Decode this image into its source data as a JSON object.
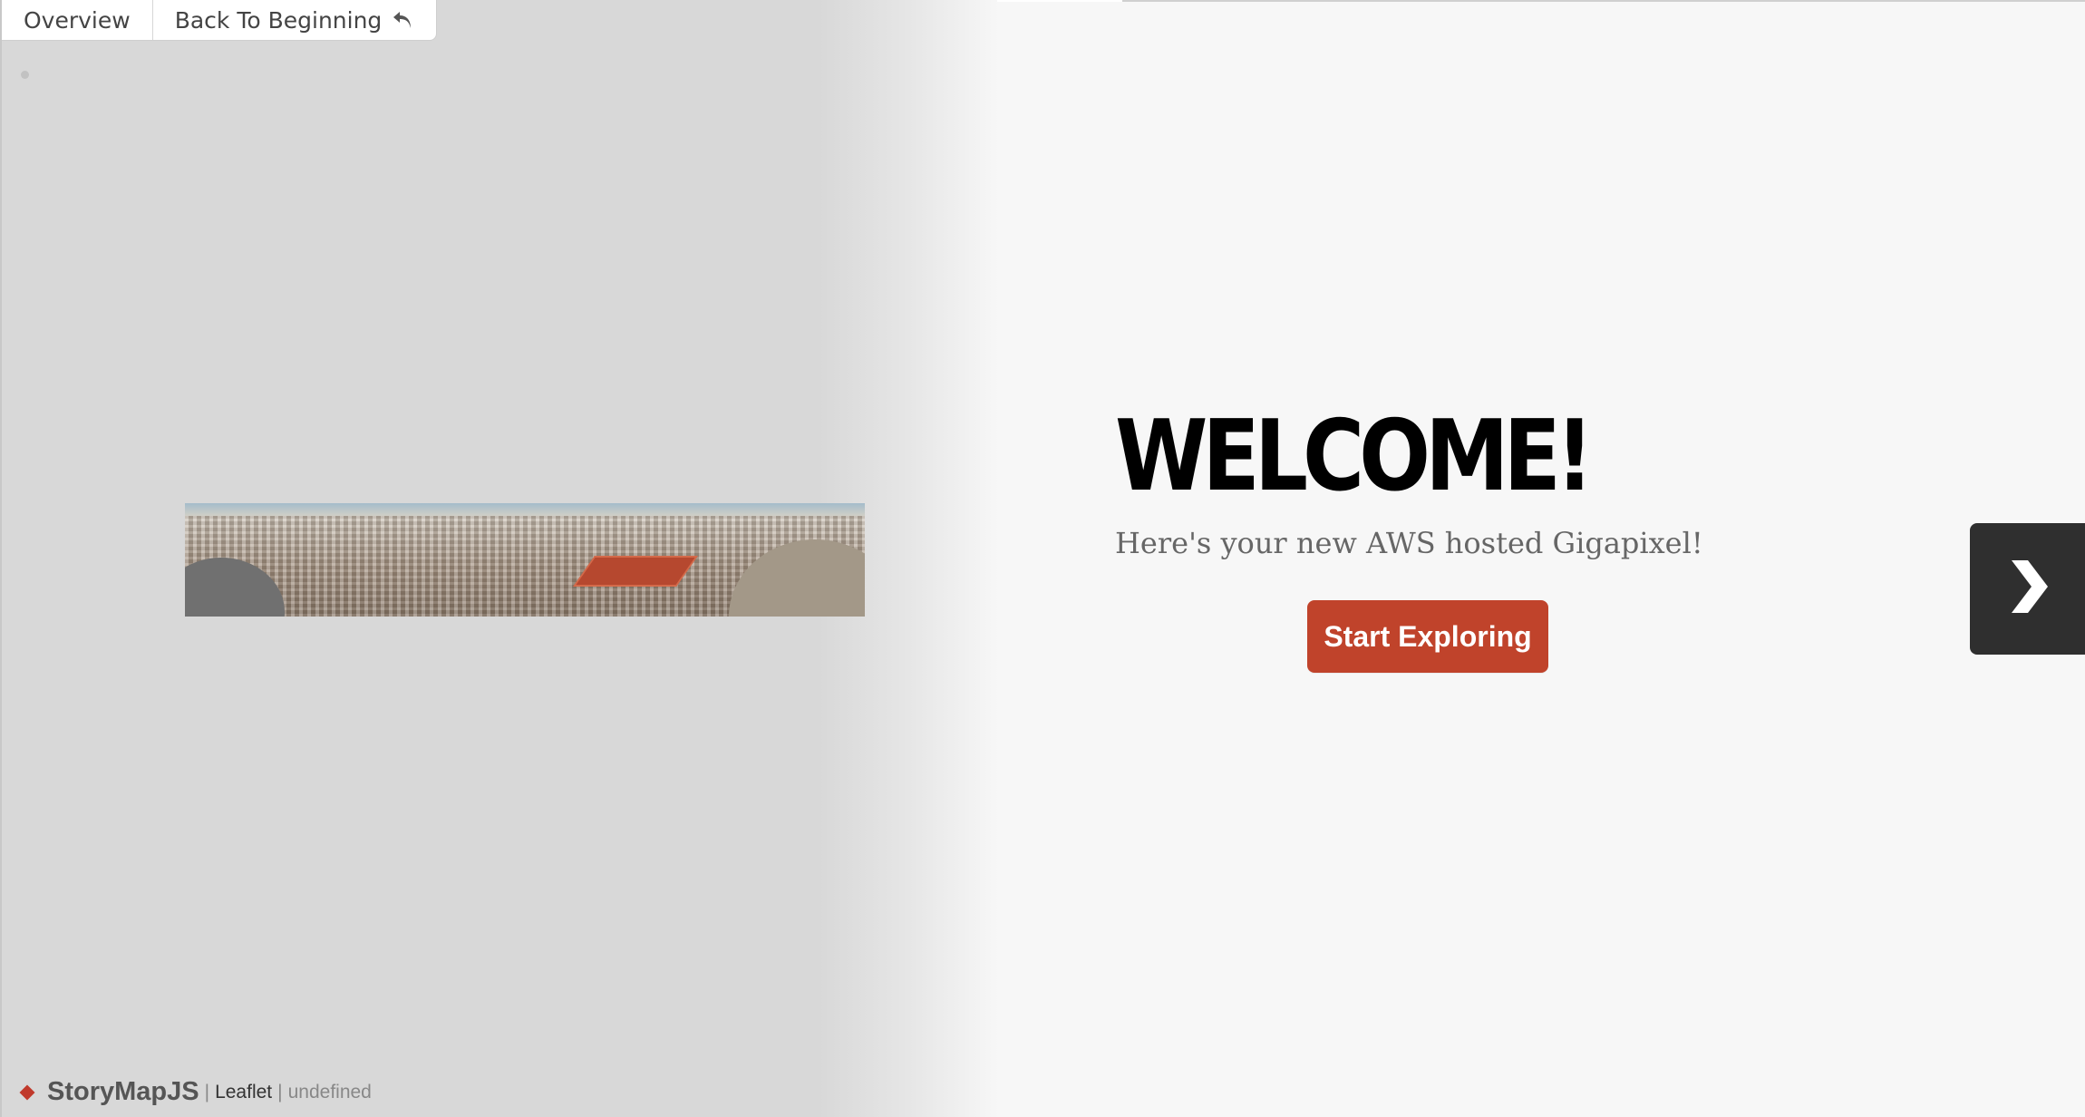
{
  "menu": {
    "overview_label": "Overview",
    "back_label": "Back To Beginning"
  },
  "slide": {
    "headline": "WELCOME!",
    "subtitle": "Here's your new AWS hosted Gigapixel!",
    "cta_label": "Start Exploring"
  },
  "attribution": {
    "brand": "StoryMapJS",
    "separator": "|",
    "map_provider": "Leaflet",
    "source": "undefined"
  },
  "icons": {
    "back": "return-arrow-icon",
    "next": "chevron-right-icon",
    "brand": "diamond-icon"
  },
  "colors": {
    "accent": "#c0432b",
    "next_button_bg": "#2f2f2f",
    "map_bg": "#d8d8d8",
    "content_bg": "#f7f7f7"
  }
}
